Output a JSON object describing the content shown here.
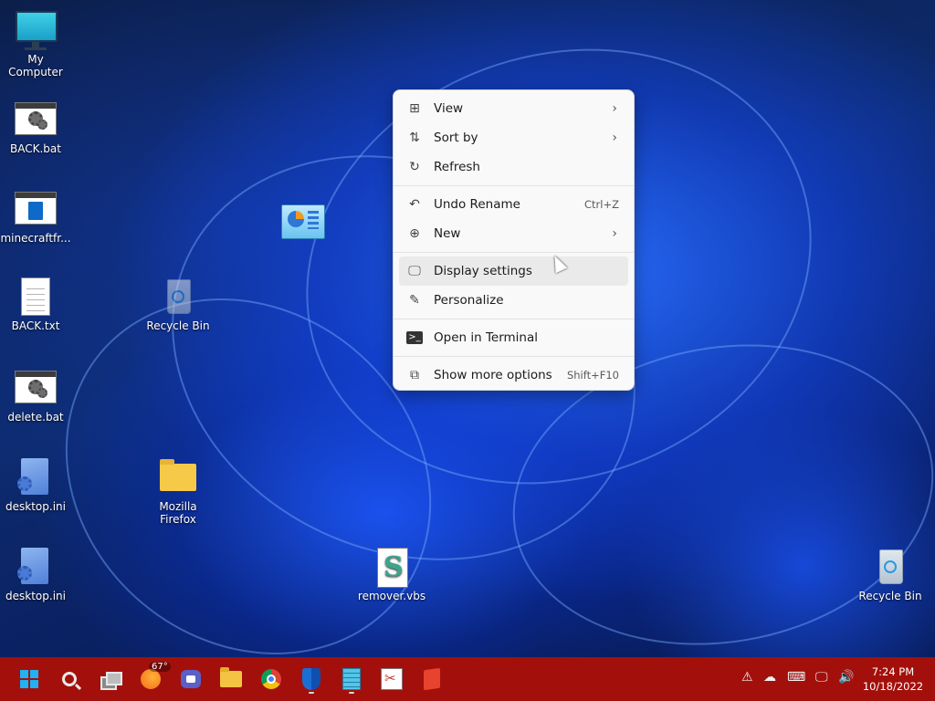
{
  "desktop": {
    "icons": [
      {
        "label": "My Computer"
      },
      {
        "label": "BACK.bat"
      },
      {
        "label": "minecraftfr..."
      },
      {
        "label": "BACK.txt"
      },
      {
        "label": "delete.bat"
      },
      {
        "label": "desktop.ini"
      },
      {
        "label": "desktop.ini"
      },
      {
        "label": "Recycle Bin"
      },
      {
        "label": "Mozilla Firefox"
      },
      {
        "label": "remover.vbs"
      },
      {
        "label": "Recycle Bin"
      }
    ]
  },
  "context_menu": {
    "items": [
      {
        "label": "View",
        "icon": "grid-icon",
        "submenu": true
      },
      {
        "label": "Sort by",
        "icon": "sort-icon",
        "submenu": true
      },
      {
        "label": "Refresh",
        "icon": "refresh-icon"
      },
      {
        "label": "Undo Rename",
        "icon": "undo-icon",
        "shortcut": "Ctrl+Z"
      },
      {
        "label": "New",
        "icon": "plus-circle-icon",
        "submenu": true
      },
      {
        "label": "Display settings",
        "icon": "display-icon",
        "hovered": true
      },
      {
        "label": "Personalize",
        "icon": "brush-icon"
      },
      {
        "label": "Open in Terminal",
        "icon": "terminal-icon"
      },
      {
        "label": "Show more options",
        "icon": "expand-icon",
        "shortcut": "Shift+F10"
      }
    ]
  },
  "taskbar": {
    "weather_temp": "67°",
    "clock_time": "7:24 PM",
    "clock_date": "10/18/2022",
    "color": "#a3100b"
  }
}
